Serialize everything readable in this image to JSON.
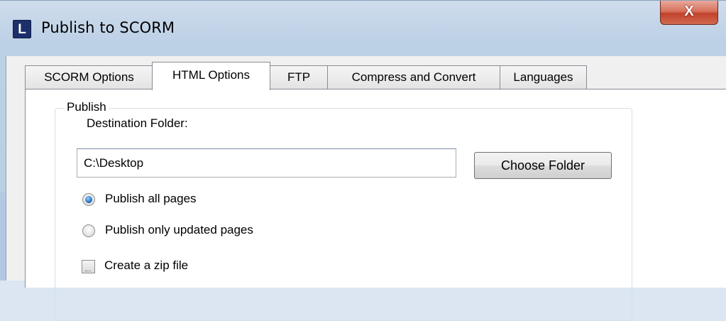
{
  "window": {
    "title": "Publish to SCORM",
    "app_icon_letter": "L",
    "close_label": "X"
  },
  "tabs": [
    {
      "label": "SCORM Options",
      "active": false
    },
    {
      "label": "HTML Options",
      "active": true
    },
    {
      "label": "FTP",
      "active": false
    },
    {
      "label": "Compress and Convert",
      "active": false
    },
    {
      "label": "Languages",
      "active": false
    }
  ],
  "publish": {
    "group_label": "Publish",
    "destination_label": "Destination Folder:",
    "destination_value": "C:\\Desktop",
    "choose_folder_label": "Choose Folder",
    "options": [
      {
        "label": "Publish all pages",
        "selected": true
      },
      {
        "label": "Publish only updated pages",
        "selected": false
      }
    ],
    "zip_label": "Create a zip file",
    "zip_checked": false
  },
  "colors": {
    "accent": "#1b63b6",
    "close_button": "#c1432b",
    "app_icon_bg": "#1d2f6b"
  }
}
